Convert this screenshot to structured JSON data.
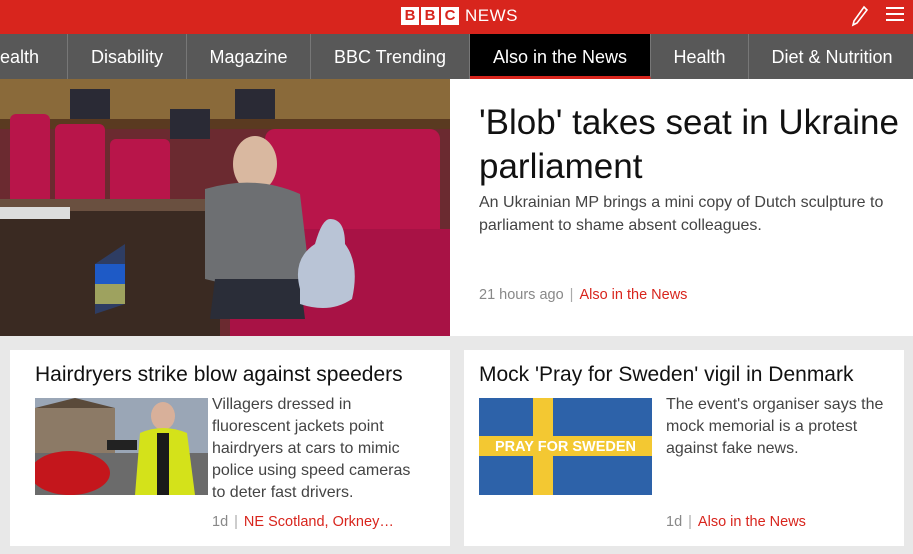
{
  "header": {
    "logo_letters": [
      "B",
      "B",
      "C"
    ],
    "logo_word": "NEWS",
    "icons": [
      "pencil-icon",
      "menu-icon"
    ],
    "brand_color": "#d8251d"
  },
  "nav": {
    "tabs": [
      "ealth",
      "Disability",
      "Magazine",
      "BBC Trending",
      "Also in the News",
      "Health",
      "Diet & Nutrition"
    ],
    "active": "Also in the News"
  },
  "hero": {
    "title": "'Blob' takes seat in Ukraine parliament",
    "summary": "An Ukrainian MP brings a mini copy of Dutch sculpture to parliament to shame absent colleagues.",
    "time": "21 hours ago",
    "section": "Also in the News"
  },
  "cards": [
    {
      "title": "Hairdryers strike blow against speeders",
      "summary": "Villagers dressed in fluorescent jackets point hairdryers at cars to mimic police using speed cameras to deter fast drivers.",
      "time": "1d",
      "section": "NE Scotland, Orkney…"
    },
    {
      "title": "Mock 'Pray for Sweden' vigil in Denmark",
      "summary": "The event's organiser says the mock memorial is a protest against fake news.",
      "time": "1d",
      "section": "Also in the News",
      "image_text": "PRAY FOR SWEDEN"
    }
  ]
}
